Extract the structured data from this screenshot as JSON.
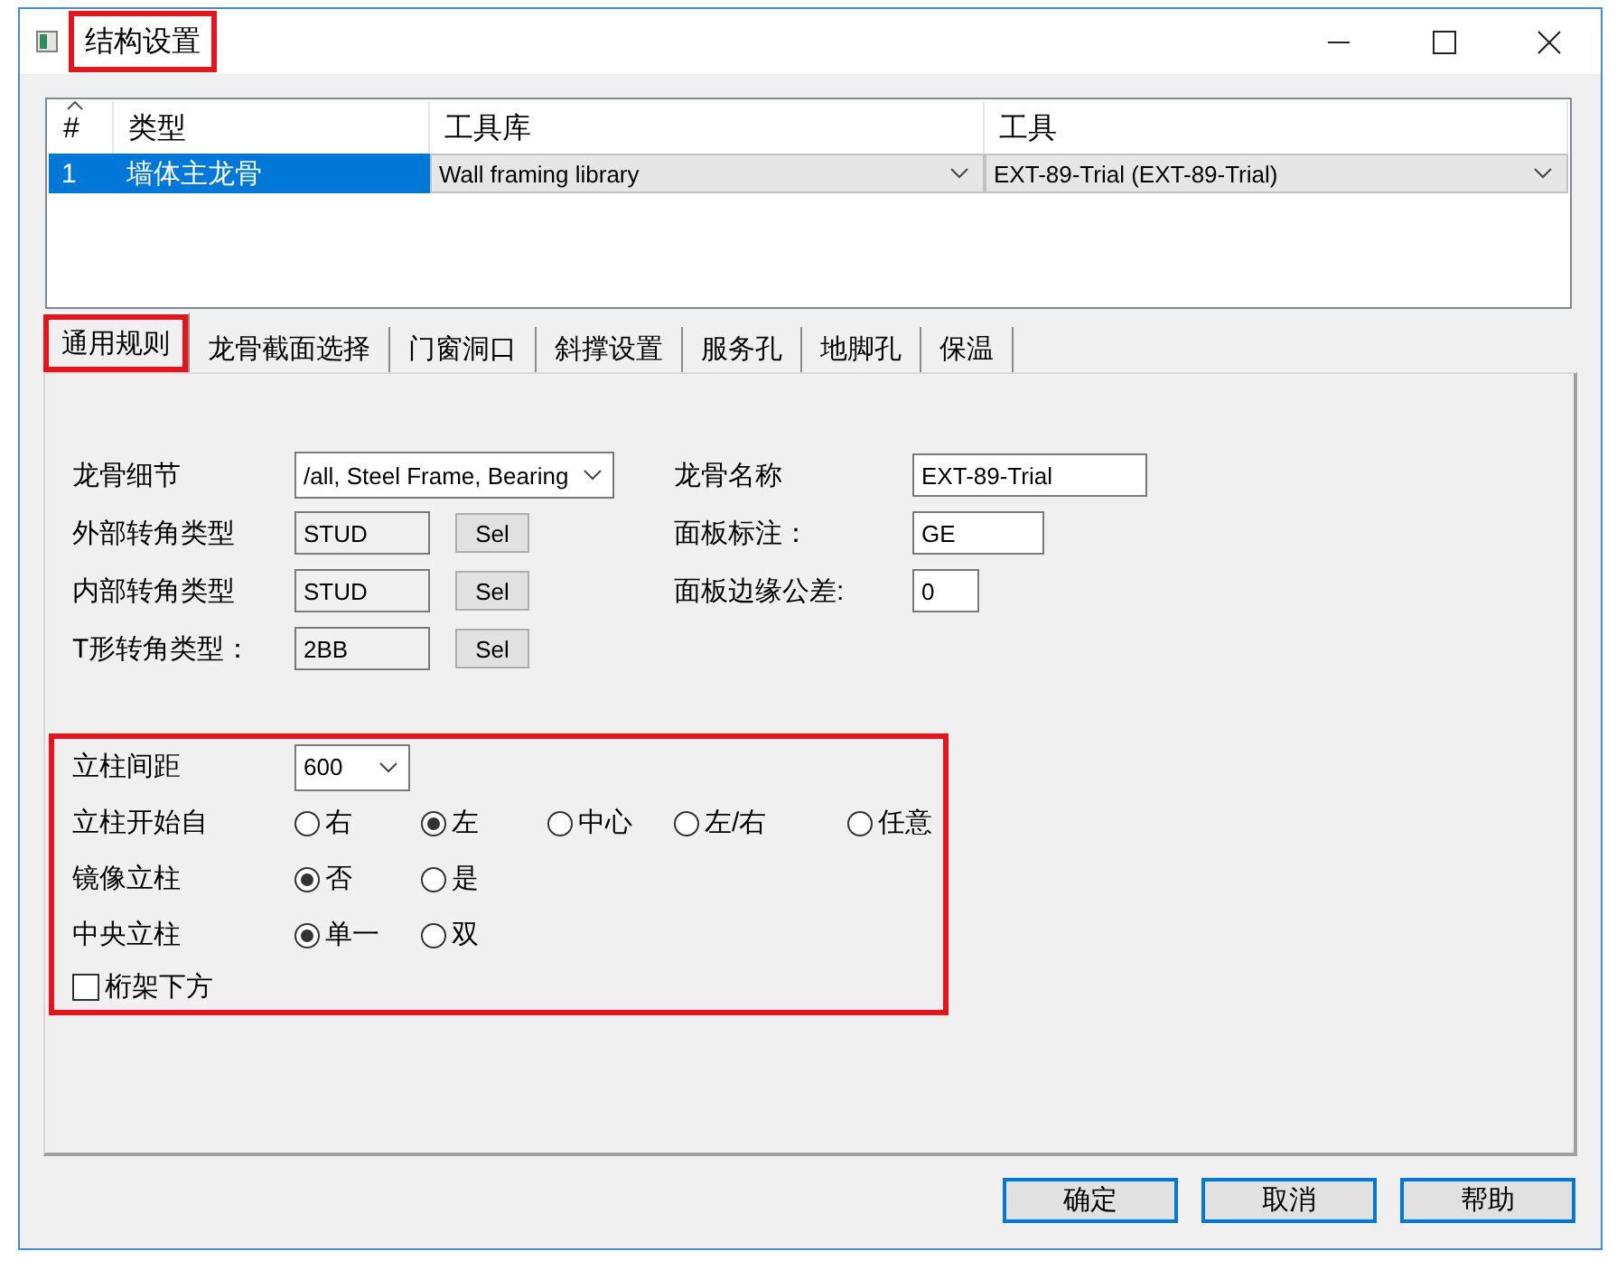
{
  "window": {
    "title": "结构设置",
    "title_highlighted": true
  },
  "table": {
    "columns": [
      {
        "label": "#",
        "sorted": true
      },
      {
        "label": "类型",
        "sorted": false
      },
      {
        "label": "工具库",
        "sorted": false
      },
      {
        "label": "工具",
        "sorted": false
      }
    ],
    "rows": [
      {
        "selected": true,
        "cells": [
          {
            "kind": "text",
            "text": "1"
          },
          {
            "kind": "text",
            "text": "墙体主龙骨"
          },
          {
            "kind": "dropdown",
            "text": "Wall framing library"
          },
          {
            "kind": "dropdown",
            "text": "EXT-89-Trial (EXT-89-Trial)"
          }
        ]
      }
    ]
  },
  "tabs": [
    {
      "label": "通用规则",
      "selected": true,
      "highlighted": true
    },
    {
      "label": "龙骨截面选择",
      "selected": false,
      "highlighted": false
    },
    {
      "label": "门窗洞口",
      "selected": false,
      "highlighted": false
    },
    {
      "label": "斜撑设置",
      "selected": false,
      "highlighted": false
    },
    {
      "label": "服务孔",
      "selected": false,
      "highlighted": false
    },
    {
      "label": "地脚孔",
      "selected": false,
      "highlighted": false
    },
    {
      "label": "保温",
      "selected": false,
      "highlighted": false
    }
  ],
  "general": {
    "left_fields": [
      {
        "kind": "dropdown",
        "label": "龙骨细节",
        "value": "/all, Steel Frame, Bearing"
      },
      {
        "kind": "picker",
        "label": "外部转角类型",
        "value": "STUD",
        "button": "Sel"
      },
      {
        "kind": "picker",
        "label": "内部转角类型",
        "value": "STUD",
        "button": "Sel"
      },
      {
        "kind": "picker",
        "label": "T形转角类型：",
        "value": "2BB",
        "button": "Sel"
      }
    ],
    "right_fields": [
      {
        "label": "龙骨名称",
        "value": "EXT-89-Trial"
      },
      {
        "label": "面板标注：",
        "value": "GE"
      },
      {
        "label": "面板边缘公差:",
        "value": "0"
      }
    ]
  },
  "stud_section": {
    "highlighted": true,
    "spacing": {
      "label": "立柱间距",
      "value": "600"
    },
    "radio_groups": [
      {
        "label": "立柱开始自",
        "options": [
          {
            "label": "右",
            "selected": false
          },
          {
            "label": "左",
            "selected": true
          },
          {
            "label": "中心",
            "selected": false
          },
          {
            "label": "左/右",
            "selected": false
          },
          {
            "label": "任意",
            "selected": false
          }
        ]
      },
      {
        "label": "镜像立柱",
        "options": [
          {
            "label": "否",
            "selected": true
          },
          {
            "label": "是",
            "selected": false
          }
        ]
      },
      {
        "label": "中央立柱",
        "options": [
          {
            "label": "单一",
            "selected": true
          },
          {
            "label": "双",
            "selected": false
          }
        ]
      }
    ],
    "checkbox": {
      "label": "桁架下方",
      "checked": false
    }
  },
  "buttons": [
    "确定",
    "取消",
    "帮助"
  ]
}
